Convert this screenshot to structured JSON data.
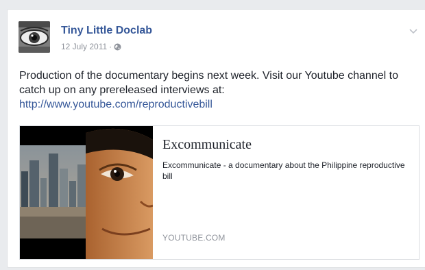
{
  "post": {
    "author": "Tiny Little Doclab",
    "date": "12 July 2011",
    "separator": "·",
    "text": "Production of the documentary begins next week. Visit our Youtube channel to catch up on any prereleased interviews at:",
    "link": "http://www.youtube.com/reproductivebill"
  },
  "preview": {
    "title": "Excommunicate",
    "description": "Excommunicate - a documentary about the Philippine reproductive bill",
    "domain": "YOUTUBE.COM"
  },
  "icons": {
    "avatar": "eye-logo",
    "privacy": "globe-icon",
    "menu": "chevron-down-icon"
  },
  "colors": {
    "link": "#365899",
    "meta": "#90949c",
    "text": "#1d2129",
    "background": "#e9ebee"
  }
}
